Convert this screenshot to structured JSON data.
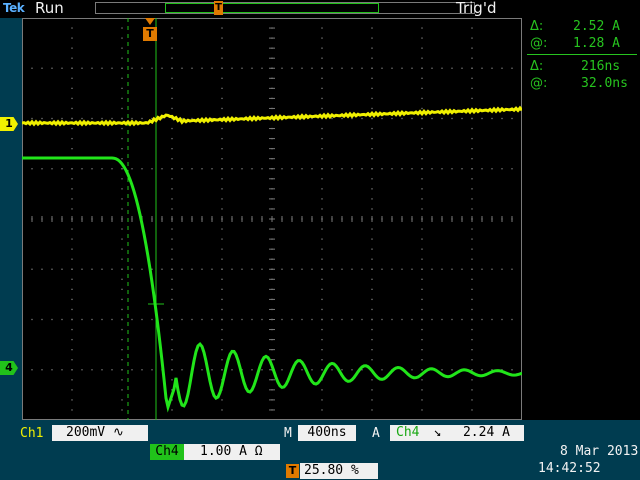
{
  "header": {
    "brand": "Tek",
    "run_state": "Run",
    "trigger_state": "Trig'd"
  },
  "record_view": {
    "trigger_marker": "T"
  },
  "markers": {
    "ch1_marker": "1",
    "ch4_marker": "4",
    "trigger_top_marker": "T"
  },
  "cursors": {
    "delta_amplitude": "2.52 A",
    "at_amplitude": "1.28 A",
    "delta_time": "216ns",
    "at_time": "32.0ns",
    "delta_symbol": "Δ:",
    "at_symbol": "@:"
  },
  "bottom": {
    "ch1_label": "Ch1",
    "ch1_scale": "200mV",
    "ch1_coupling": "∿",
    "ch4_label": "Ch4",
    "ch4_scale": "1.00 A Ω",
    "timebase_label": "M",
    "timebase_value": "400ns",
    "trigger_source_prefix": "A",
    "trigger_source": "Ch4",
    "trigger_slope": "↘",
    "trigger_level": "2.24 A",
    "trigger_pos_marker": "T",
    "trigger_position": "25.80 %",
    "date": "8 Mar  2013",
    "time": "14:42:52"
  },
  "colors": {
    "ch1": "#f0f000",
    "ch4": "#21e51a",
    "grid": "#808080",
    "panel": "#003c50",
    "cursor": "#27c41f"
  }
}
